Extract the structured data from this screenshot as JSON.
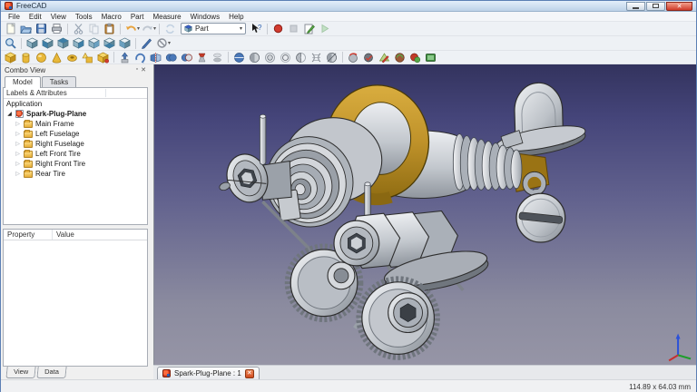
{
  "window": {
    "title": "FreeCAD",
    "controls": [
      "minimize",
      "maximize",
      "close"
    ],
    "status_dimensions": "114.89 x 64.03 mm"
  },
  "menu": {
    "items": [
      "File",
      "Edit",
      "View",
      "Tools",
      "Macro",
      "Part",
      "Measure",
      "Windows",
      "Help"
    ]
  },
  "toolbars": {
    "standard_icons": [
      "new-file",
      "open-file",
      "save-file",
      "print",
      "cut",
      "copy",
      "paste",
      "undo",
      "redo",
      "refresh"
    ],
    "workbench_selector": {
      "value": "Part",
      "icon": "part-workbench-cube"
    },
    "help_icon": "whats-this",
    "macro_icons": [
      "macro-record",
      "macro-stop",
      "macro-edit",
      "macro-play"
    ],
    "view_icons": [
      "fit-all",
      "view-axonometric",
      "view-front",
      "view-top",
      "view-right",
      "view-rear",
      "view-bottom",
      "view-left",
      "measure-linear",
      "measure-clear-all"
    ],
    "part_primitive_icons": [
      "part-box",
      "part-cylinder",
      "part-sphere",
      "part-cone",
      "part-torus",
      "part-primitives",
      "part-shape-builder"
    ],
    "part_modify_icons": [
      "part-extrude",
      "part-revolve",
      "part-mirror",
      "part-boolean-union",
      "part-boolean-cut",
      "part-loft",
      "part-compound"
    ],
    "part_section_icons": [
      "part-cross-sections",
      "part-section",
      "part-offset-3d",
      "part-offset-2d",
      "part-thickness",
      "part-ruled-surface",
      "part-sweep"
    ],
    "part_tool_icons": [
      "part-defeaturing",
      "part-check-geometry",
      "part-refine-shape",
      "part-reverse-shape",
      "part-simple-copy",
      "part-export-view"
    ]
  },
  "combo_view": {
    "title": "Combo View",
    "tabs": [
      "Model",
      "Tasks"
    ],
    "active_tab": "Model",
    "tree_header": "Labels & Attributes",
    "tree": {
      "root": "Application",
      "document": "Spark-Plug-Plane",
      "children": [
        "Main Frame",
        "Left Fuselage",
        "Right Fuselage",
        "Left Front Tire",
        "Right Front Tire",
        "Rear Tire"
      ]
    },
    "property_panel": {
      "columns": [
        "Property",
        "Value"
      ]
    },
    "bottom_tabs": [
      "View",
      "Data"
    ]
  },
  "mdi": {
    "tab_label": "Spark-Plug-Plane : 1"
  },
  "viewport": {
    "model_name": "Spark-Plug-Plane",
    "axis_indicator": "xyz-axis-cross",
    "colors": {
      "background_top": "#33335e",
      "background_bottom": "#9695a6",
      "brass_ring": "#c6992e",
      "brass_dark": "#8a6812",
      "metal_light": "#e6e8ec",
      "metal_mid": "#aab0b8",
      "metal_dark": "#70767e",
      "edge_line": "#2e2e2e"
    }
  }
}
